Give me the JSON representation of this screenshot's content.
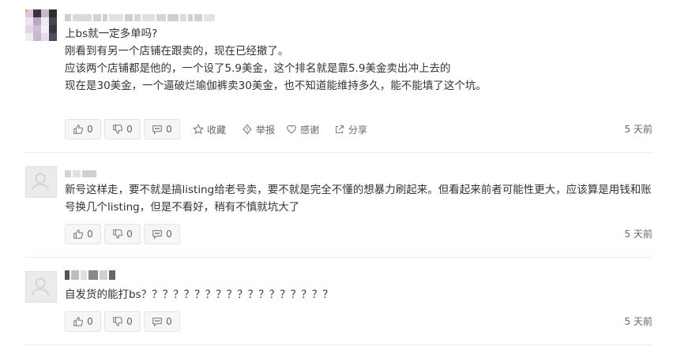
{
  "comments": [
    {
      "badge": "1",
      "lines": [
        "上bs就一定多单吗?",
        "刚看到有另一个店铺在跟卖的，现在已经撤了。",
        "应该两个店铺都是他的，一个设了5.9美金，这个排名就是靠5.9美金卖出冲上去的",
        "现在是30美金，一个逼破烂瑜伽裤卖30美金，也不知道能维持多久，能不能填了这个坑。"
      ],
      "likes": "0",
      "dislikes": "0",
      "replies": "0",
      "collect_label": "收藏",
      "report_label": "举报",
      "thanks_label": "感谢",
      "share_label": "分享",
      "time": "5 天前"
    },
    {
      "text": "新号这样走，要不就是搞listing给老号卖，要不就是完全不懂的想暴力刷起来。但看起来前者可能性更大，应该算是用钱和账号换几个listing，但是不看好，稍有不慎就坑大了",
      "likes": "0",
      "dislikes": "0",
      "replies": "0",
      "time": "5 天前"
    },
    {
      "text": "自发货的能打bs？？？？？？？？？？？？？？？？？？",
      "likes": "0",
      "dislikes": "0",
      "replies": "0",
      "time": "5 天前"
    }
  ],
  "colors": {
    "text": "#333333",
    "muted": "#666666",
    "pill_bg": "#f6f6f6",
    "badge": "#f5a623"
  },
  "icons": [
    "thumb-up-icon",
    "thumb-down-icon",
    "comment-icon",
    "star-icon",
    "shield-warning-icon",
    "heart-icon",
    "share-icon",
    "user-icon"
  ]
}
